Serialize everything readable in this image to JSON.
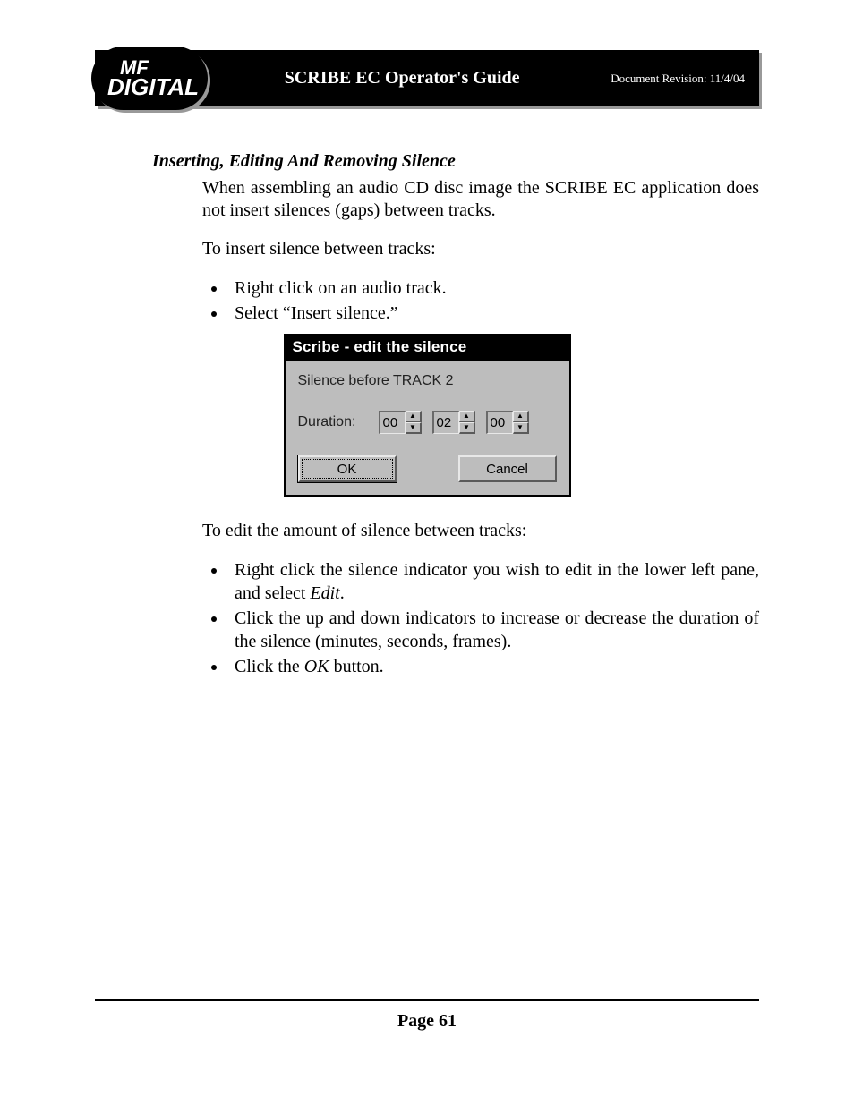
{
  "header": {
    "logo_line1": "MF",
    "logo_line2": "DIGITAL",
    "title": "SCRIBE EC Operator's Guide",
    "revision": "Document Revision: 11/4/04"
  },
  "section_heading": "Inserting, Editing And Removing Silence",
  "para1": "When assembling an audio CD disc image the SCRIBE EC application does not insert silences (gaps) between tracks.",
  "para2": "To insert silence between tracks:",
  "steps1": [
    "Right click on an audio track.",
    "Select “Insert silence.”"
  ],
  "dialog": {
    "title": "Scribe - edit the silence",
    "subtitle": "Silence before TRACK 2",
    "duration_label": "Duration:",
    "minutes": "00",
    "seconds": "02",
    "frames": "00",
    "ok": "OK",
    "cancel": "Cancel"
  },
  "para3": "To edit the amount of silence between tracks:",
  "steps2": [
    {
      "pre": "Right click the silence indicator you wish to edit in the lower left pane, and select ",
      "it": "Edit",
      "post": "."
    },
    {
      "pre": "Click the up and down indicators to increase or decrease the duration of the silence (minutes, seconds, frames).",
      "it": "",
      "post": ""
    },
    {
      "pre": "Click the ",
      "it": "OK",
      "post": " button."
    }
  ],
  "footer": {
    "page": "Page 61"
  }
}
